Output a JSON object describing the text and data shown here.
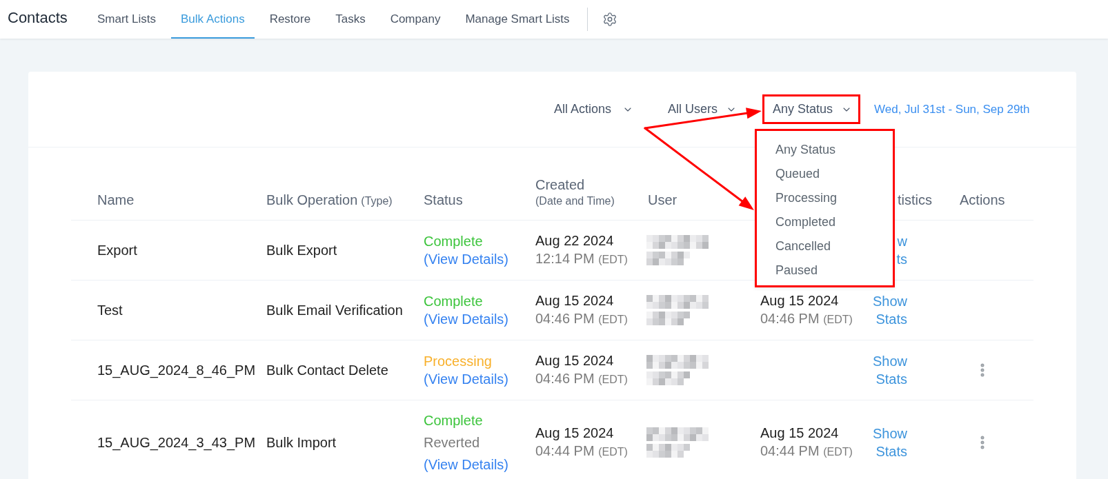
{
  "app": {
    "title": "Contacts"
  },
  "nav_tabs": [
    {
      "label": "Smart Lists",
      "selected": false
    },
    {
      "label": "Bulk Actions",
      "selected": true
    },
    {
      "label": "Restore",
      "selected": false
    },
    {
      "label": "Tasks",
      "selected": false
    },
    {
      "label": "Company",
      "selected": false
    },
    {
      "label": "Manage Smart Lists",
      "selected": false
    }
  ],
  "filters": [
    {
      "label": "All Actions",
      "highlighted": false
    },
    {
      "label": "All Users",
      "highlighted": false
    },
    {
      "label": "Any Status",
      "highlighted": true,
      "menu": {
        "highlighted": true,
        "options": [
          "Any Status",
          "Queued",
          "Processing",
          "Completed",
          "Cancelled",
          "Paused"
        ]
      }
    }
  ],
  "date_range": "Wed, Jul 31st - Sun, Sep 29th",
  "table": {
    "columns": [
      {
        "label": "Name"
      },
      {
        "label": "Bulk Operation",
        "note": "(Type)"
      },
      {
        "label": "Status"
      },
      {
        "label": "Created",
        "note": "(Date and Time)"
      },
      {
        "label": "User"
      },
      {
        "label": "tistics"
      },
      {
        "label": "Actions"
      }
    ],
    "rows": [
      {
        "name": "Export",
        "operation": "Bulk Export",
        "status": [
          {
            "label": "Complete",
            "kind": "complete"
          }
        ],
        "details_link": "(View Details)",
        "created": {
          "date": "Aug 22 2024",
          "time": "12:14 PM",
          "zone": "(EDT)"
        },
        "stats_link": "w ts",
        "has_menu": false
      },
      {
        "name": "Test",
        "operation": "Bulk Email Verification",
        "status": [
          {
            "label": "Complete",
            "kind": "complete"
          }
        ],
        "details_link": "(View Details)",
        "created": {
          "date": "Aug 15 2024",
          "time": "04:46 PM",
          "zone": "(EDT)"
        },
        "completed": {
          "date": "Aug 15 2024",
          "time": "04:46 PM",
          "zone": "(EDT)"
        },
        "stats_link": "Show Stats",
        "has_menu": false
      },
      {
        "name": "15_AUG_2024_8_46_PM",
        "operation": "Bulk Contact Delete",
        "status": [
          {
            "label": "Processing",
            "kind": "processing"
          }
        ],
        "details_link": "(View Details)",
        "created": {
          "date": "Aug 15 2024",
          "time": "04:46 PM",
          "zone": "(EDT)"
        },
        "stats_link": "Show Stats",
        "has_menu": true
      },
      {
        "name": "15_AUG_2024_3_43_PM",
        "operation": "Bulk Import",
        "status": [
          {
            "label": "Complete",
            "kind": "complete"
          },
          {
            "label": "Reverted",
            "kind": "reverted"
          }
        ],
        "details_link": "(View Details)",
        "created": {
          "date": "Aug 15 2024",
          "time": "04:44 PM",
          "zone": "(EDT)"
        },
        "completed": {
          "date": "Aug 15 2024",
          "time": "04:44 PM",
          "zone": "(EDT)"
        },
        "stats_link": "Show Stats",
        "has_menu": true
      }
    ]
  }
}
